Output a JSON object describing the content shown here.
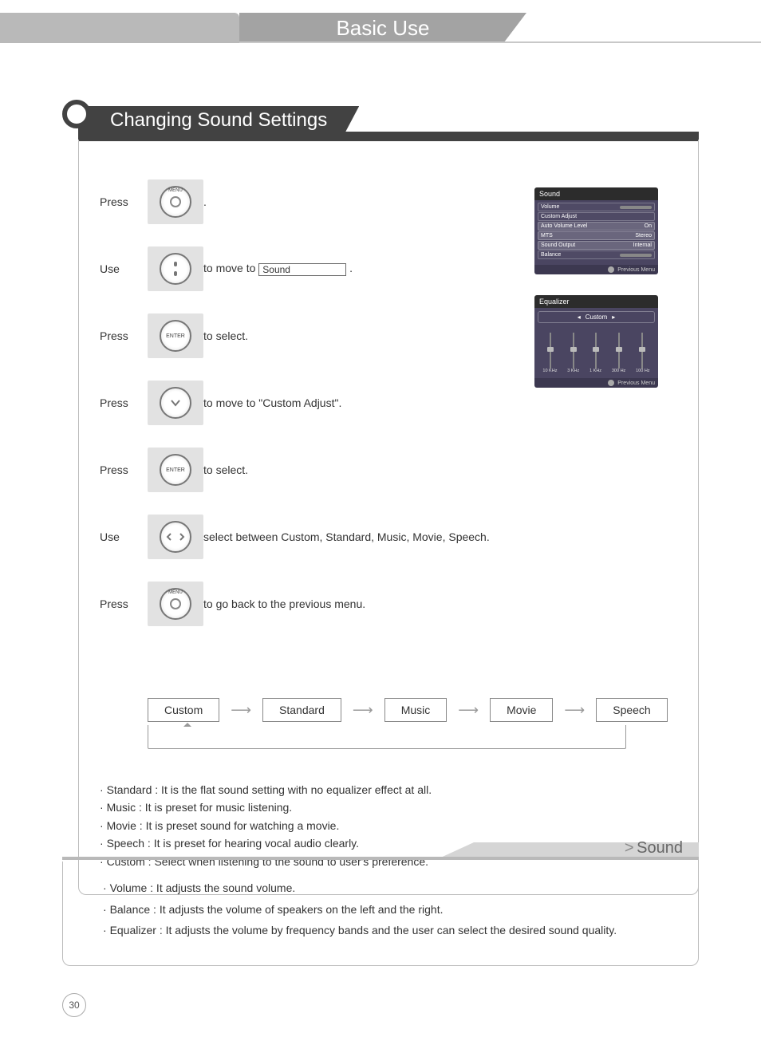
{
  "header": {
    "tab": "Basic Use"
  },
  "section": {
    "title": "Changing Sound Settings"
  },
  "steps": [
    {
      "label": "Press",
      "icon": "menu",
      "text": "."
    },
    {
      "label": "Use",
      "icon": "dpad",
      "text_pre": "to move to ",
      "box": "Sound",
      "text_post": "."
    },
    {
      "label": "Press",
      "icon": "enter",
      "text": "to select."
    },
    {
      "label": "Press",
      "icon": "down",
      "text": "to move to \"Custom Adjust\"."
    },
    {
      "label": "Press",
      "icon": "enter",
      "text": "to select."
    },
    {
      "label": "Use",
      "icon": "lr",
      "text": "select between Custom, Standard, Music, Movie, Speech."
    },
    {
      "label": "Press",
      "icon": "menu",
      "text": "to go back to the previous menu."
    }
  ],
  "osd_sound": {
    "title": "Sound",
    "rows": [
      {
        "l": "Volume",
        "r": ""
      },
      {
        "l": "Custom Adjust",
        "r": ""
      },
      {
        "l": "Auto Volume Level",
        "r": "On"
      },
      {
        "l": "MTS",
        "r": "Stereo"
      },
      {
        "l": "Sound Output",
        "r": "Internal"
      },
      {
        "l": "Balance",
        "r": ""
      }
    ],
    "foot": "Previous Menu"
  },
  "osd_eq": {
    "title": "Equalizer",
    "mode": "Custom",
    "labels": [
      "10 KHz",
      "3 KHz",
      "1 KHz",
      "300 Hz",
      "100 Hz"
    ],
    "foot": "Previous Menu"
  },
  "flow": [
    "Custom",
    "Standard",
    "Music",
    "Movie",
    "Speech"
  ],
  "presets": [
    "Standard : It is the flat sound setting with no equalizer effect at all.",
    "Music : It is preset for music listening.",
    "Movie : It is preset sound for watching a movie.",
    "Speech : It is preset for hearing vocal audio clearly.",
    "Custom : Select when listening to the sound to user's preference."
  ],
  "sound": {
    "title": "Sound",
    "items": [
      "Volume : It adjusts the sound volume.",
      "Balance : It adjusts the volume of speakers on the left and the right.",
      "Equalizer : It adjusts the volume by frequency bands and the user can select the desired sound quality."
    ]
  },
  "page_number": "30"
}
